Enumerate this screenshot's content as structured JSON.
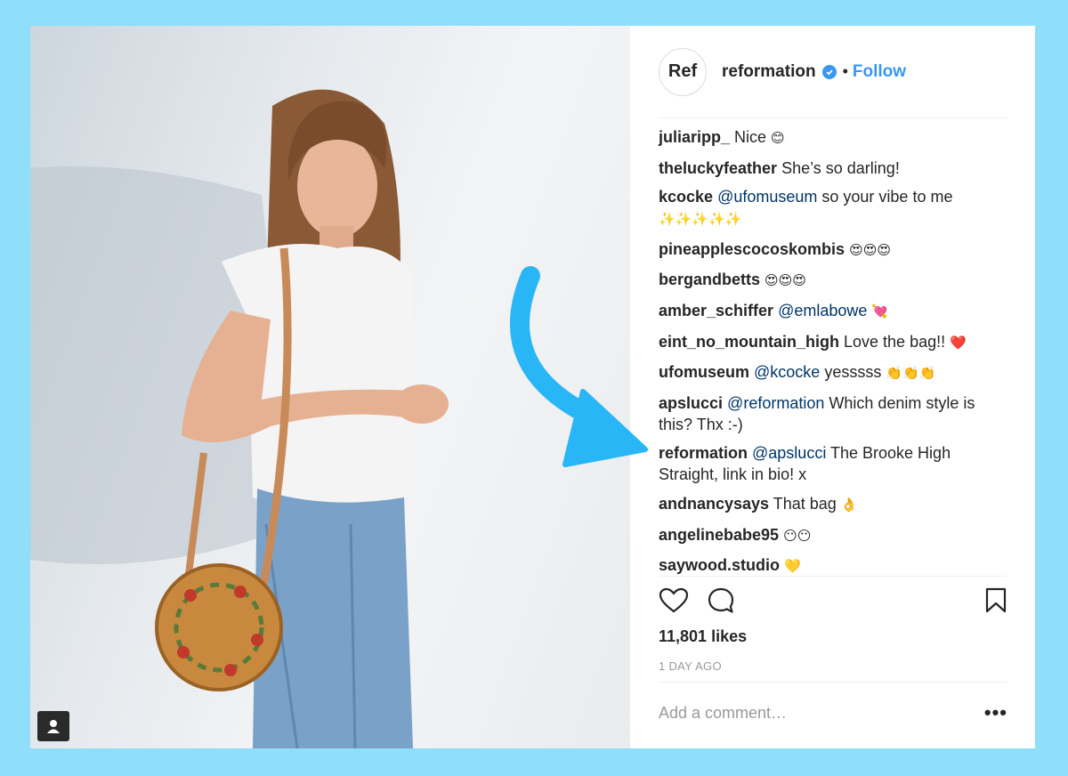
{
  "post": {
    "avatar_text": "Ref",
    "username": "reformation",
    "separator": "•",
    "follow_label": "Follow",
    "comments": [
      {
        "user": "juliaripp_",
        "parts": [
          {
            "t": "text",
            "v": " Nice "
          },
          {
            "t": "emoji",
            "v": "😊"
          }
        ]
      },
      {
        "user": "theluckyfeather",
        "parts": [
          {
            "t": "text",
            "v": " She’s so darling!"
          }
        ]
      },
      {
        "user": "kcocke",
        "parts": [
          {
            "t": "mention",
            "v": " @ufomuseum"
          },
          {
            "t": "text",
            "v": " so your vibe to me "
          },
          {
            "t": "emoji",
            "v": "✨✨✨✨✨"
          }
        ]
      },
      {
        "user": "pineapplescocoskombis",
        "parts": [
          {
            "t": "text",
            "v": " "
          },
          {
            "t": "emoji",
            "v": "😍😍😍"
          }
        ]
      },
      {
        "user": "bergandbetts",
        "parts": [
          {
            "t": "text",
            "v": " "
          },
          {
            "t": "emoji",
            "v": "😍😍😍"
          }
        ]
      },
      {
        "user": "amber_schiffer",
        "parts": [
          {
            "t": "mention",
            "v": " @emlabowe"
          },
          {
            "t": "text",
            "v": " "
          },
          {
            "t": "emoji",
            "v": "💘"
          }
        ]
      },
      {
        "user": "eint_no_mountain_high",
        "parts": [
          {
            "t": "text",
            "v": " Love the bag!! "
          },
          {
            "t": "emoji",
            "v": "❤️"
          }
        ]
      },
      {
        "user": "ufomuseum",
        "parts": [
          {
            "t": "mention",
            "v": " @kcocke"
          },
          {
            "t": "text",
            "v": " yesssss "
          },
          {
            "t": "emoji",
            "v": "👏👏👏"
          }
        ]
      },
      {
        "user": "apslucci",
        "parts": [
          {
            "t": "mention",
            "v": " @reformation"
          },
          {
            "t": "text",
            "v": " Which denim style is this? Thx :-)"
          }
        ]
      },
      {
        "user": "reformation",
        "parts": [
          {
            "t": "mention",
            "v": " @apslucci"
          },
          {
            "t": "text",
            "v": " The Brooke High Straight, link in bio! x"
          }
        ]
      },
      {
        "user": "andnancysays",
        "parts": [
          {
            "t": "text",
            "v": " That bag "
          },
          {
            "t": "emoji",
            "v": "👌"
          }
        ]
      },
      {
        "user": "angelinebabe95",
        "parts": [
          {
            "t": "text",
            "v": " "
          },
          {
            "t": "emoji",
            "v": "😶😶"
          }
        ]
      },
      {
        "user": "saywood.studio",
        "parts": [
          {
            "t": "text",
            "v": " "
          },
          {
            "t": "emoji",
            "v": "💛"
          }
        ]
      }
    ],
    "likes_label": "11,801 likes",
    "time_label": "1 DAY AGO",
    "comment_placeholder": "Add a comment…",
    "more_label": "•••"
  },
  "colors": {
    "background": "#8fdffb",
    "link_blue": "#3897f0",
    "mention": "#003569",
    "arrow": "#29b6f6"
  },
  "icons": {
    "like": "heart-icon",
    "comment": "comment-bubble-icon",
    "save": "bookmark-icon",
    "verified": "verified-badge-icon",
    "user_tag": "user-tag-icon"
  }
}
